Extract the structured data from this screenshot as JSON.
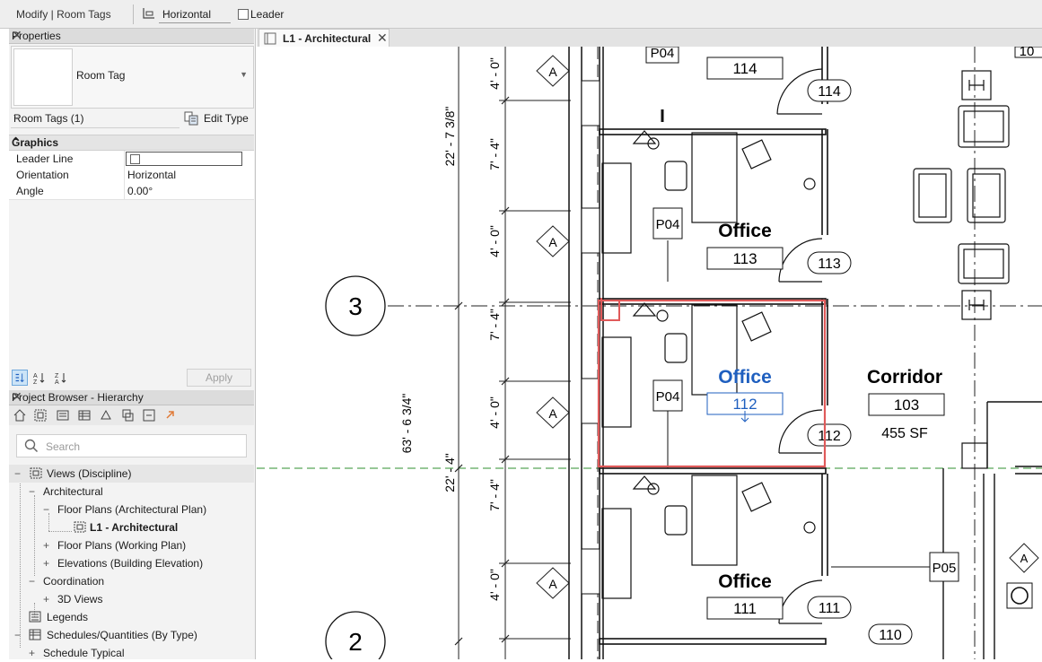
{
  "options_bar": {
    "context": "Modify | Room Tags",
    "orientation": "Horizontal",
    "leader_label": "Leader",
    "leader_checked": false
  },
  "properties": {
    "title": "Properties",
    "type_name": "Room Tag",
    "instance_selector": "Room Tags (1)",
    "edit_type": "Edit Type",
    "group": "Graphics",
    "rows": [
      {
        "key": "Leader Line",
        "value": "",
        "checked": false
      },
      {
        "key": "Orientation",
        "value": "Horizontal"
      },
      {
        "key": "Angle",
        "value": "0.00°"
      }
    ],
    "apply_label": "Apply"
  },
  "project_browser": {
    "title": "Project Browser - Hierarchy",
    "search_placeholder": "Search",
    "tree": [
      {
        "label": "Views (Discipline)",
        "toggle": "−"
      },
      {
        "label": "Architectural",
        "toggle": "−"
      },
      {
        "label": "Floor Plans (Architectural Plan)",
        "toggle": "−"
      },
      {
        "label": "L1 - Architectural",
        "toggle": "",
        "bold": true
      },
      {
        "label": "Floor Plans (Working Plan)",
        "toggle": "+"
      },
      {
        "label": "Elevations (Building Elevation)",
        "toggle": "+"
      },
      {
        "label": "Coordination",
        "toggle": "−"
      },
      {
        "label": "3D Views",
        "toggle": "+"
      },
      {
        "label": "Legends",
        "toggle": ""
      },
      {
        "label": "Schedules/Quantities (By Type)",
        "toggle": "−"
      },
      {
        "label": "Schedule Typical",
        "toggle": "+"
      }
    ]
  },
  "view_tab": {
    "label": "L1 - Architectural",
    "close": "✕"
  },
  "drawing": {
    "grids": [
      "3",
      "2"
    ],
    "dimensions": {
      "top_overall": "22' - 7 3/8\"",
      "overall": "63' - 6 3/4\"",
      "lower": "22' - 4\"",
      "seg_a": "4' - 0\"",
      "seg_b": "7' - 4\""
    },
    "room_name": "Office",
    "rooms": [
      "114",
      "113",
      "112",
      "111"
    ],
    "door_tags": [
      "114",
      "113",
      "112",
      "111",
      "110"
    ],
    "type_tag": "P04",
    "type_tag_b": "P05",
    "elev_tag": "A",
    "corridor": {
      "name": "Corridor",
      "number": "103",
      "area": "455 SF"
    },
    "edge_label": "10",
    "selection_color": "#e05a5a",
    "tag_color": "#1f5fbf"
  }
}
